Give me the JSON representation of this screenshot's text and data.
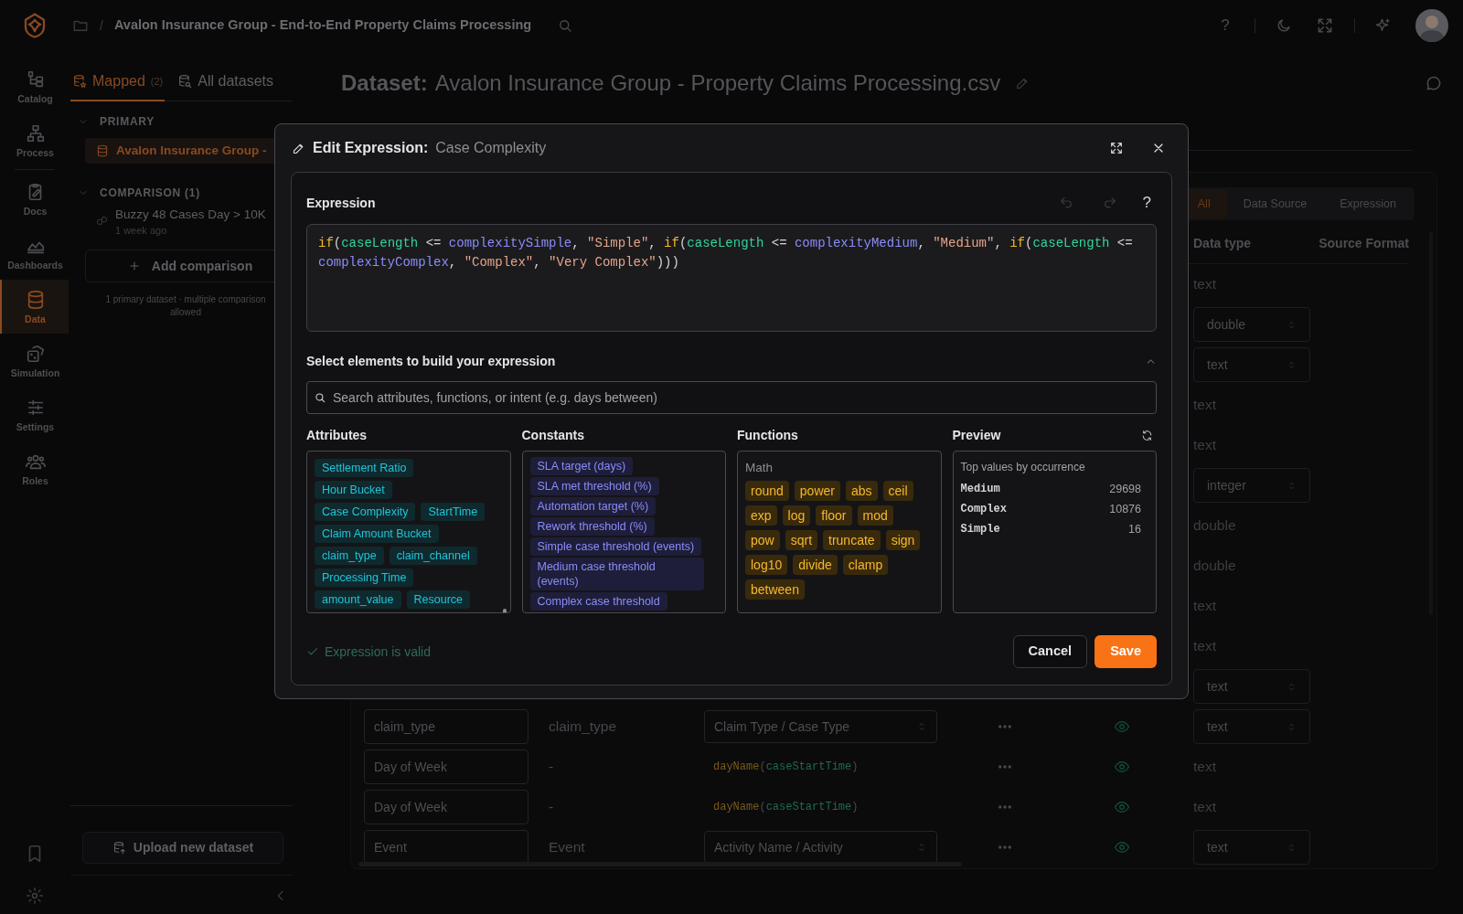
{
  "topbar": {
    "separator": "/",
    "title": "Avalon Insurance Group - End-to-End Property Claims Processing",
    "help": "?"
  },
  "rail": {
    "items": [
      {
        "label": "Catalog",
        "selected": false
      },
      {
        "label": "Process",
        "selected": false
      },
      {
        "label": "Docs",
        "selected": false
      },
      {
        "label": "Dashboards",
        "selected": false
      },
      {
        "label": "Data",
        "selected": true
      },
      {
        "label": "Simulation",
        "selected": false
      },
      {
        "label": "Settings",
        "selected": false
      },
      {
        "label": "Roles",
        "selected": false
      }
    ]
  },
  "datasets_panel": {
    "tabs": [
      {
        "label": "Mapped",
        "count": "(2)",
        "selected": true
      },
      {
        "label": "All datasets",
        "selected": false
      }
    ],
    "primary": {
      "heading": "PRIMARY",
      "items": [
        {
          "name": "Avalon Insurance Group -",
          "selected": true
        }
      ]
    },
    "comparison": {
      "heading": "COMPARISON (1)",
      "items": [
        {
          "name": "Buzzy 48 Cases Day > 10K",
          "time": "1 week ago"
        }
      ]
    },
    "add_button": "Add comparison",
    "note": "1 primary dataset · multiple comparison allowed",
    "upload_button": "Upload new dataset"
  },
  "main": {
    "label": "Dataset:",
    "title": "Avalon Insurance Group - Property Claims Processing.csv",
    "filters": [
      {
        "label": "All",
        "selected": true
      },
      {
        "label": "Data Source",
        "selected": false
      },
      {
        "label": "Expression",
        "selected": false
      }
    ],
    "columns": [
      "Data type",
      "Source Format"
    ],
    "rows": [
      {
        "data_type": "text",
        "kind": "plain"
      },
      {
        "data_type": "double",
        "kind": "select"
      },
      {
        "data_type": "text",
        "kind": "select"
      },
      {
        "data_type": "text",
        "kind": "plain"
      },
      {
        "data_type": "text",
        "kind": "plain"
      },
      {
        "data_type": "integer",
        "kind": "select"
      },
      {
        "data_type": "double",
        "kind": "plain"
      },
      {
        "data_type": "double",
        "kind": "plain"
      },
      {
        "data_type": "text",
        "kind": "plain"
      },
      {
        "data_type": "text",
        "kind": "plain"
      },
      {
        "data_type": "text",
        "kind": "select"
      },
      {
        "name": "claim_type",
        "source": "claim_type",
        "mapping": {
          "kind": "select",
          "text": "Claim Type / Case Type"
        },
        "data_type": "text",
        "kind": "select"
      },
      {
        "name": "Day of Week",
        "source": "-",
        "mapping": {
          "kind": "expression",
          "tokens": [
            {
              "kind": "fn",
              "text": "dayName"
            },
            {
              "kind": "punct",
              "text": "("
            },
            {
              "kind": "attr",
              "text": "caseStartTime"
            },
            {
              "kind": "punct",
              "text": ")"
            }
          ]
        },
        "data_type": "text",
        "kind": "plain"
      },
      {
        "name": "Day of Week",
        "source": "-",
        "mapping": {
          "kind": "expression",
          "tokens": [
            {
              "kind": "fn",
              "text": "dayName"
            },
            {
              "kind": "punct",
              "text": "("
            },
            {
              "kind": "attr",
              "text": "caseStartTime"
            },
            {
              "kind": "punct",
              "text": ")"
            }
          ]
        },
        "data_type": "text",
        "kind": "plain"
      },
      {
        "name": "Event",
        "source": "Event",
        "mapping": {
          "kind": "select",
          "text": "Activity Name / Activity"
        },
        "data_type": "text",
        "kind": "select"
      }
    ]
  },
  "modal": {
    "title_label": "Edit Expression:",
    "title_value": "Case Complexity",
    "expression_label": "Expression",
    "undo_disabled": true,
    "redo_disabled": true,
    "help": "?",
    "code": [
      {
        "kind": "fn",
        "text": "if"
      },
      {
        "kind": "punct",
        "text": "("
      },
      {
        "kind": "attr",
        "text": "caseLength"
      },
      {
        "kind": "punct",
        "text": " <= "
      },
      {
        "kind": "const",
        "text": "complexitySimple"
      },
      {
        "kind": "punct",
        "text": ", "
      },
      {
        "kind": "str",
        "text": "\"Simple\""
      },
      {
        "kind": "punct",
        "text": ", "
      },
      {
        "kind": "fn",
        "text": "if"
      },
      {
        "kind": "punct",
        "text": "("
      },
      {
        "kind": "attr",
        "text": "caseLength"
      },
      {
        "kind": "punct",
        "text": " <= "
      },
      {
        "kind": "const",
        "text": "complexityMedium"
      },
      {
        "kind": "punct",
        "text": ", "
      },
      {
        "kind": "str",
        "text": "\"Medium\""
      },
      {
        "kind": "punct",
        "text": ", "
      },
      {
        "kind": "fn",
        "text": "if"
      },
      {
        "kind": "punct",
        "text": "("
      },
      {
        "kind": "attr",
        "text": "caseLength"
      },
      {
        "kind": "punct",
        "text": " <= "
      },
      {
        "kind": "const",
        "text": "complexityComplex"
      },
      {
        "kind": "punct",
        "text": ", "
      },
      {
        "kind": "str",
        "text": "\"Complex\""
      },
      {
        "kind": "punct",
        "text": ", "
      },
      {
        "kind": "str",
        "text": "\"Very Complex\""
      },
      {
        "kind": "punct",
        "text": ")))"
      }
    ],
    "builder_title": "Select elements to build your expression",
    "builder_expanded": true,
    "search_placeholder": "Search attributes, functions, or intent (e.g. days between)",
    "attributes": {
      "heading": "Attributes",
      "items": [
        "Settlement Ratio",
        "Hour Bucket",
        "Case Complexity",
        "StartTime",
        "Claim Amount Bucket",
        "claim_type",
        "claim_channel",
        "Processing Time",
        "amount_value",
        "Resource"
      ]
    },
    "constants": {
      "heading": "Constants",
      "items": [
        "SLA target (days)",
        "SLA met threshold (%)",
        "Automation target (%)",
        "Rework threshold (%)",
        "Simple case threshold (events)",
        "Medium case threshold (events)",
        "Complex case threshold"
      ]
    },
    "functions": {
      "heading": "Functions",
      "groups": [
        {
          "name": "Math",
          "items": [
            "round",
            "power",
            "abs",
            "ceil",
            "exp",
            "log",
            "floor",
            "mod",
            "pow",
            "sqrt",
            "truncate",
            "sign",
            "log10",
            "divide",
            "clamp",
            "between"
          ]
        }
      ]
    },
    "preview": {
      "heading": "Preview",
      "caption": "Top values by occurrence",
      "rows": [
        {
          "value": "Medium",
          "count": "29698"
        },
        {
          "value": "Complex",
          "count": "10876"
        },
        {
          "value": "Simple",
          "count": "16"
        }
      ]
    },
    "status": "Expression is valid",
    "status_valid": true,
    "cancel": "Cancel",
    "save": "Save"
  }
}
